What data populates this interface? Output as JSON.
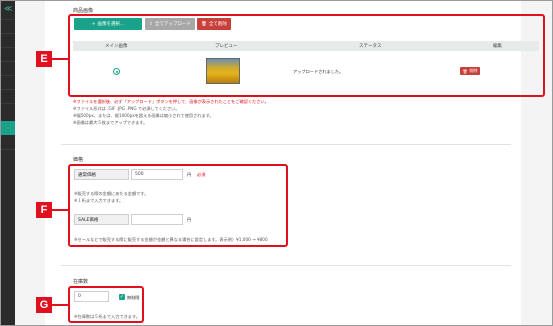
{
  "image_section": {
    "title": "商品画像",
    "buttons": {
      "select": "画像を選択...",
      "upload_all": "全てアップロード",
      "delete_all": "全て削除"
    },
    "table_headers": {
      "main": "メイン画像",
      "preview": "プレビュー",
      "status": "ステータス",
      "edit": "編集"
    },
    "row": {
      "status": "アップロードされました。",
      "delete": "削除"
    },
    "notes": [
      "※ファイルを選択後、必ず「アップロード」ボタンを押して、画像が表示されたことをご確認ください。",
      "※ファイル形式は .GIF .JPG .PNG で必須してください。",
      "※幅500px、または、縦1000pxを超える画像は縮小されて使用されます。",
      "※画像は最大５枚までアップできます。"
    ]
  },
  "price_section": {
    "title": "価格",
    "regular_label": "通常価格",
    "regular_value": "500",
    "yen": "円",
    "required": "必須",
    "regular_help": [
      "※販売する際の金額にあたる金額です。",
      "※１桁まで入力できます。"
    ],
    "sale_label": "SALE価格",
    "sale_value": "",
    "sale_help": "※セールなどで販売する際に販売する金額が金額と異なる場合に設定します。表示例）¥1,000 → ¥800"
  },
  "stock_section": {
    "title": "在庫数",
    "value": "0",
    "unlimited": "無制限",
    "help": "※在庫数は５桁まで入力できます。"
  },
  "markers": {
    "e": "E",
    "f": "F",
    "g": "G"
  },
  "colors": {
    "accent": "#1aa28a",
    "danger": "#c8403a",
    "callout": "#e0101f"
  }
}
